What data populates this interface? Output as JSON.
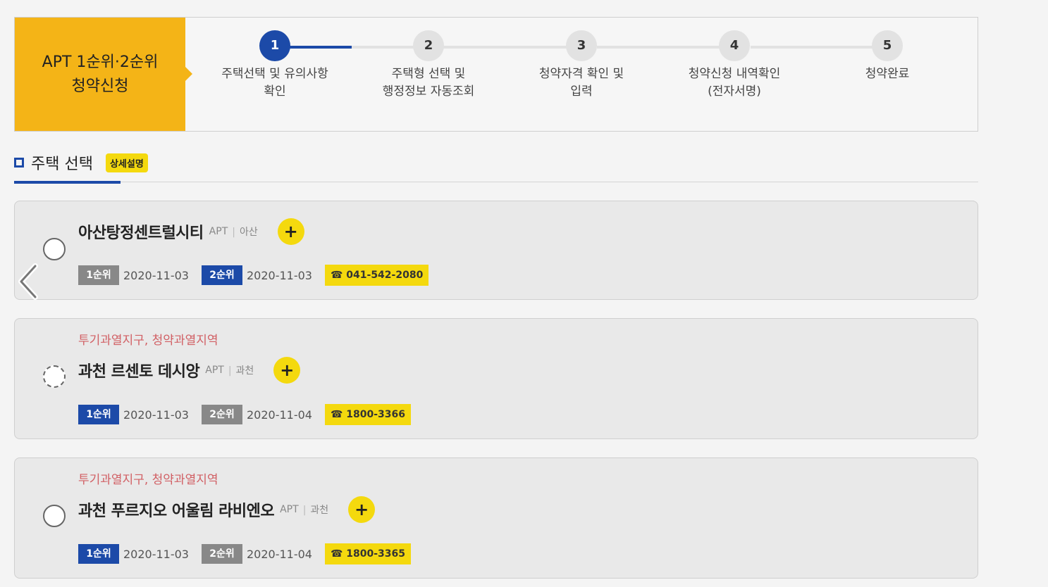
{
  "stepper": {
    "title_line1": "APT 1순위·2순위",
    "title_line2": "청약신청",
    "steps": [
      {
        "num": "1",
        "label": "주택선택 및 유의사항\n확인"
      },
      {
        "num": "2",
        "label": "주택형 선택 및\n행정정보 자동조회"
      },
      {
        "num": "3",
        "label": "청약자격 확인 및\n입력"
      },
      {
        "num": "4",
        "label": "청약신청 내역확인\n(전자서명)"
      },
      {
        "num": "5",
        "label": "청약완료"
      }
    ]
  },
  "section": {
    "title": "주택 선택",
    "detail_badge": "상세설명"
  },
  "houses": [
    {
      "tag": "",
      "name": "아산탕정센트럴시티",
      "type": "APT",
      "region": "아산",
      "rank1_label": "1순위",
      "rank1_date": "2020-11-03",
      "rank2_label": "2순위",
      "rank2_date": "2020-11-03",
      "phone": "☎ 041-542-2080"
    },
    {
      "tag": "투기과열지구, 청약과열지역",
      "name": "과천 르센토 데시앙",
      "type": "APT",
      "region": "과천",
      "rank1_label": "1순위",
      "rank1_date": "2020-11-03",
      "rank2_label": "2순위",
      "rank2_date": "2020-11-04",
      "phone": "☎ 1800-3366"
    },
    {
      "tag": "투기과열지구, 청약과열지역",
      "name": "과천 푸르지오 어울림 라비엔오",
      "type": "APT",
      "region": "과천",
      "rank1_label": "1순위",
      "rank1_date": "2020-11-03",
      "rank2_label": "2순위",
      "rank2_date": "2020-11-04",
      "phone": "☎ 1800-3365"
    }
  ],
  "colors": {
    "accent_yellow": "#f4b417",
    "brand_blue": "#1c4aa8",
    "badge_yellow": "#f4d90e"
  }
}
